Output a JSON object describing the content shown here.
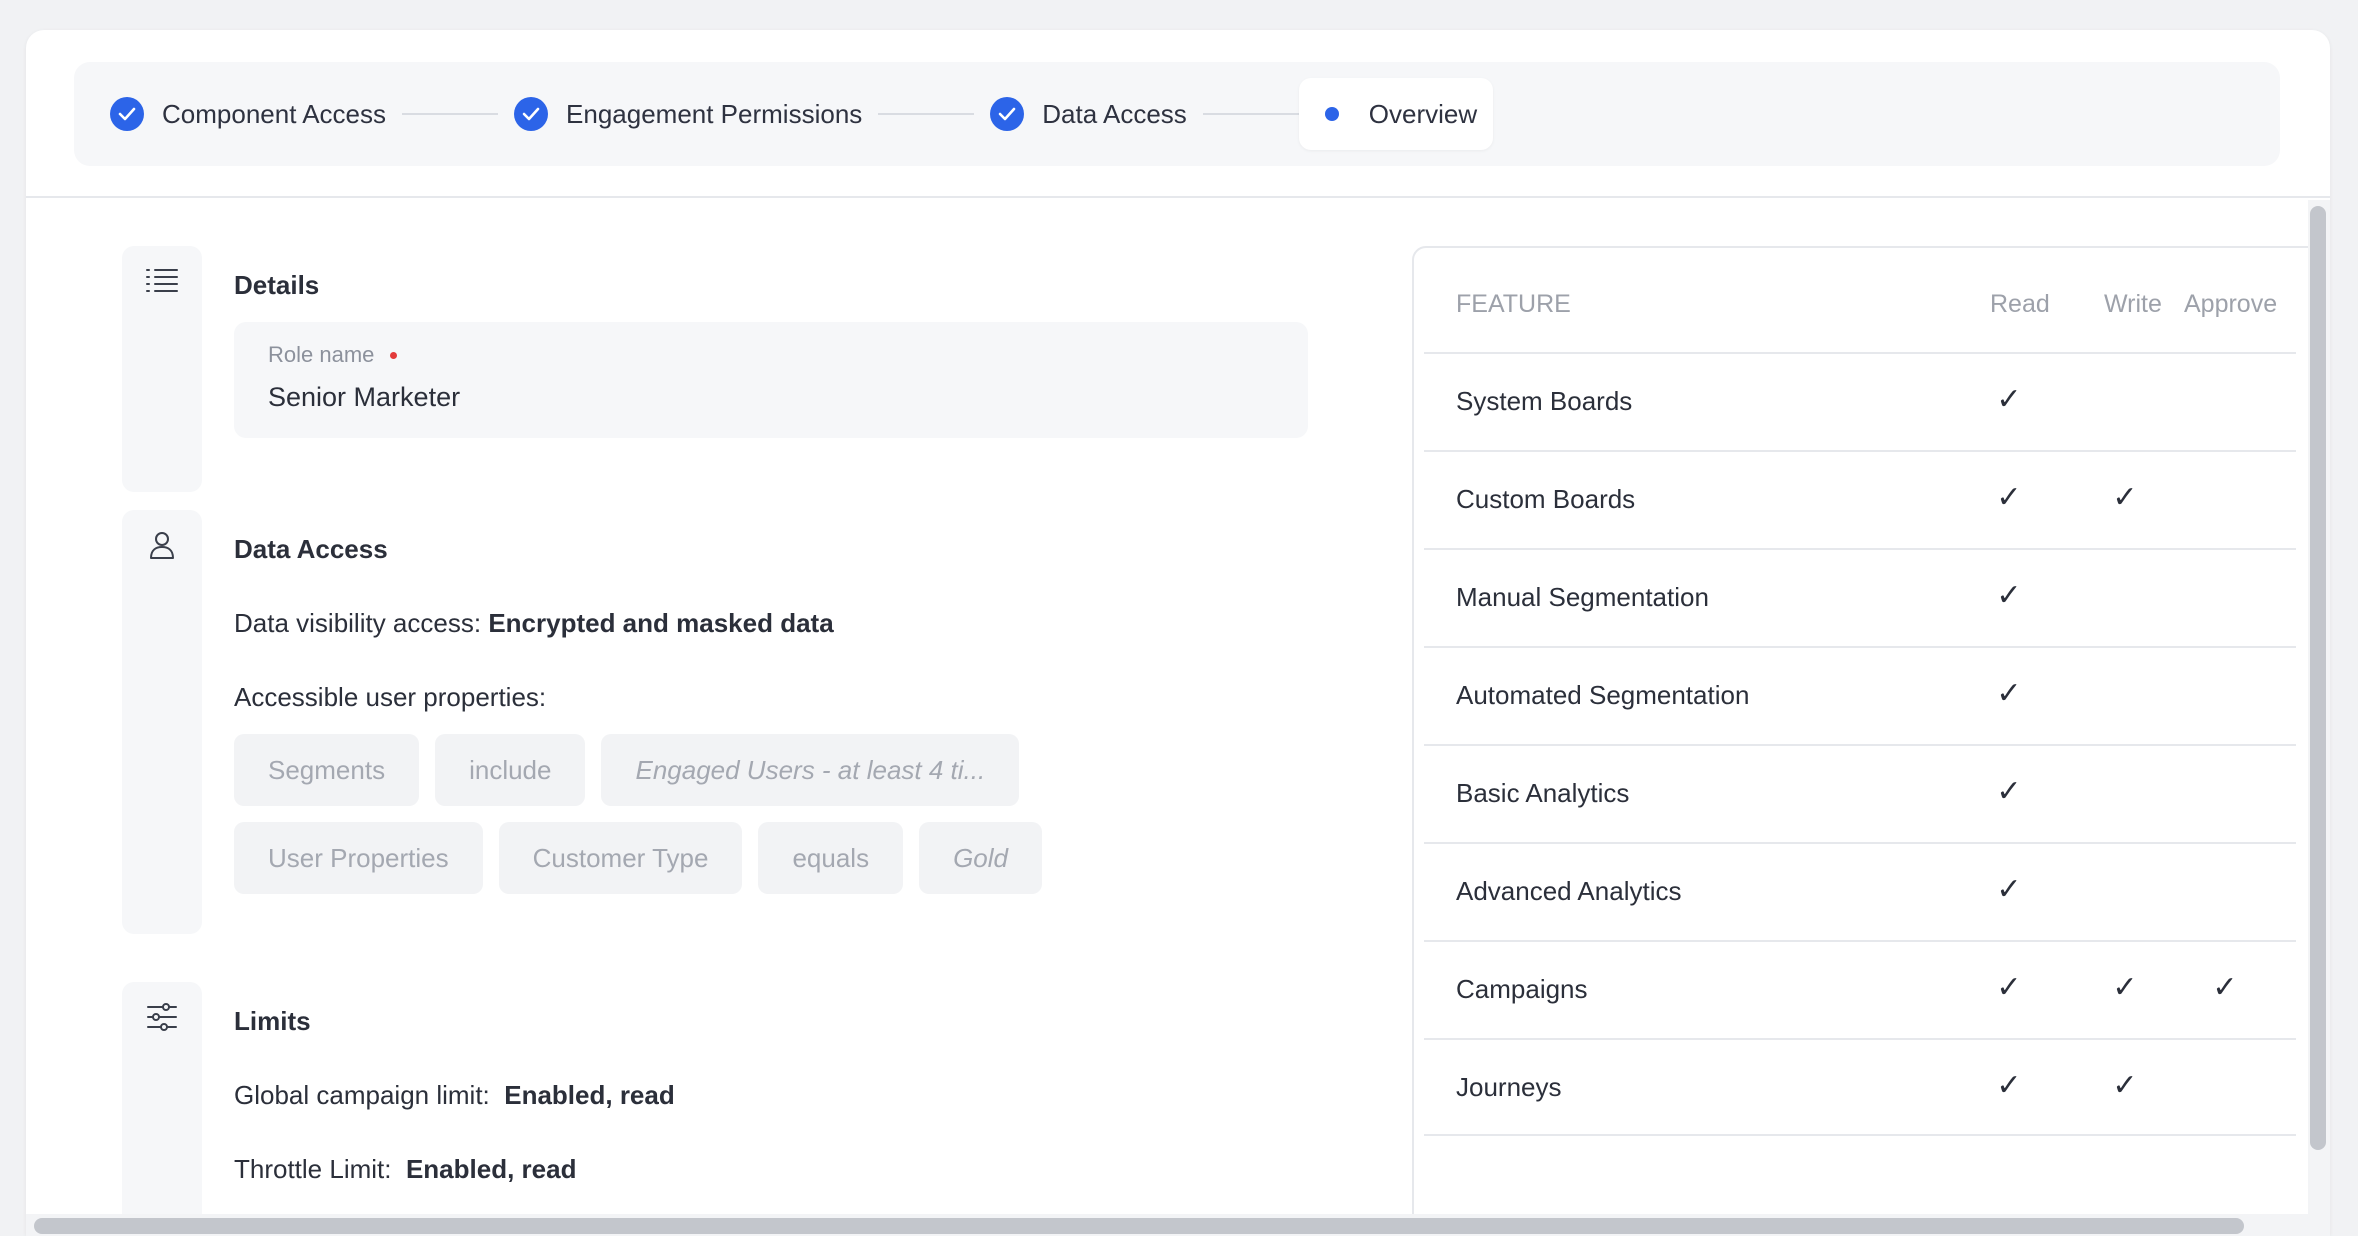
{
  "stepper": {
    "steps": [
      {
        "label": "Component Access",
        "state": "done"
      },
      {
        "label": "Engagement Permissions",
        "state": "done"
      },
      {
        "label": "Data Access",
        "state": "done"
      },
      {
        "label": "Overview",
        "state": "active"
      }
    ]
  },
  "details": {
    "title": "Details",
    "role_label": "Role name",
    "role_value": "Senior Marketer"
  },
  "data_access": {
    "title": "Data Access",
    "visibility_label": "Data visibility access:",
    "visibility_value": "Encrypted and masked data",
    "properties_label": "Accessible user properties:",
    "rule_rows": [
      [
        "Segments",
        "include",
        "Engaged Users - at least 4 ti..."
      ],
      [
        "User Properties",
        "Customer Type",
        "equals",
        "Gold"
      ]
    ]
  },
  "limits": {
    "title": "Limits",
    "global_label": "Global campaign limit:",
    "global_value": "Enabled, read",
    "throttle_label": "Throttle Limit:",
    "throttle_value": "Enabled, read"
  },
  "permissions_table": {
    "headers": {
      "feature": "FEATURE",
      "read": "Read",
      "write": "Write",
      "approve": "Approve"
    },
    "check_glyph": "✓",
    "rows": [
      {
        "feature": "System Boards",
        "read": true,
        "write": false,
        "approve": false
      },
      {
        "feature": "Custom Boards",
        "read": true,
        "write": true,
        "approve": false
      },
      {
        "feature": "Manual Segmentation",
        "read": true,
        "write": false,
        "approve": false
      },
      {
        "feature": "Automated Segmentation",
        "read": true,
        "write": false,
        "approve": false
      },
      {
        "feature": "Basic Analytics",
        "read": true,
        "write": false,
        "approve": false
      },
      {
        "feature": "Advanced Analytics",
        "read": true,
        "write": false,
        "approve": false
      },
      {
        "feature": "Campaigns",
        "read": true,
        "write": true,
        "approve": true
      },
      {
        "feature": "Journeys",
        "read": true,
        "write": true,
        "approve": false
      }
    ]
  },
  "colors": {
    "accent": "#2c64e8",
    "required": "#e33b3b"
  }
}
